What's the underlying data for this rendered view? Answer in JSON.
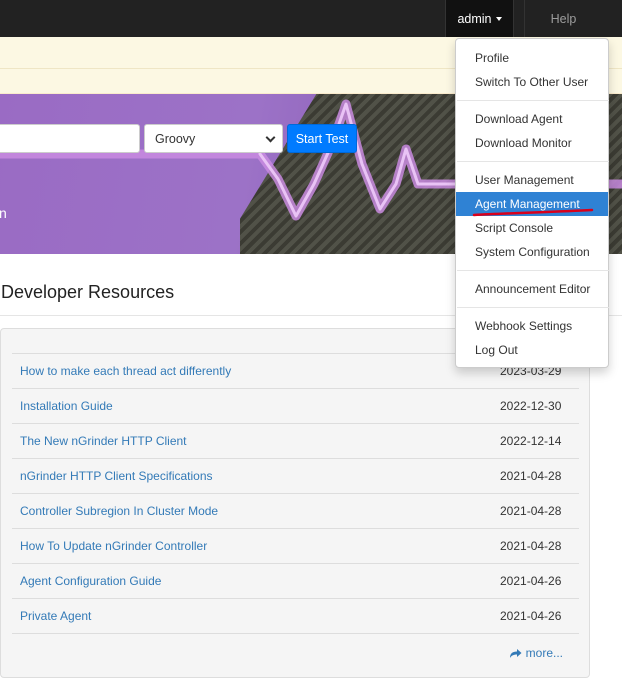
{
  "topbar": {
    "admin_label": "admin",
    "help_label": "Help"
  },
  "test_form": {
    "script_language": "Groovy",
    "start_button": "Start Test",
    "banner_text_fragment": "n"
  },
  "developer_resources": {
    "title": "Developer Resources",
    "items": [
      {
        "title": "How to make each thread act differently",
        "date": "2023-03-29"
      },
      {
        "title": "Installation Guide",
        "date": "2022-12-30"
      },
      {
        "title": "The New nGrinder HTTP Client",
        "date": "2022-12-14"
      },
      {
        "title": "nGrinder HTTP Client Specifications",
        "date": "2021-04-28"
      },
      {
        "title": "Controller Subregion In Cluster Mode",
        "date": "2021-04-28"
      },
      {
        "title": "How To Update nGrinder Controller",
        "date": "2021-04-28"
      },
      {
        "title": "Agent Configuration Guide",
        "date": "2021-04-26"
      },
      {
        "title": "Private Agent",
        "date": "2021-04-26"
      }
    ],
    "more_label": "more..."
  },
  "admin_menu": {
    "items": [
      "Profile",
      "Switch To Other User",
      "Download Agent",
      "Download Monitor",
      "User Management",
      "Agent Management",
      "Script Console",
      "System Configuration",
      "Announcement Editor",
      "Webhook Settings",
      "Log Out"
    ],
    "active_item": "Agent Management"
  },
  "colors": {
    "link": "#337ab7",
    "active_menu": "#2f82d4",
    "start_button": "#007bff",
    "annotation": "#d9001b"
  },
  "icons": {
    "more": "share-arrow-icon",
    "caret": "caret-down-icon"
  }
}
